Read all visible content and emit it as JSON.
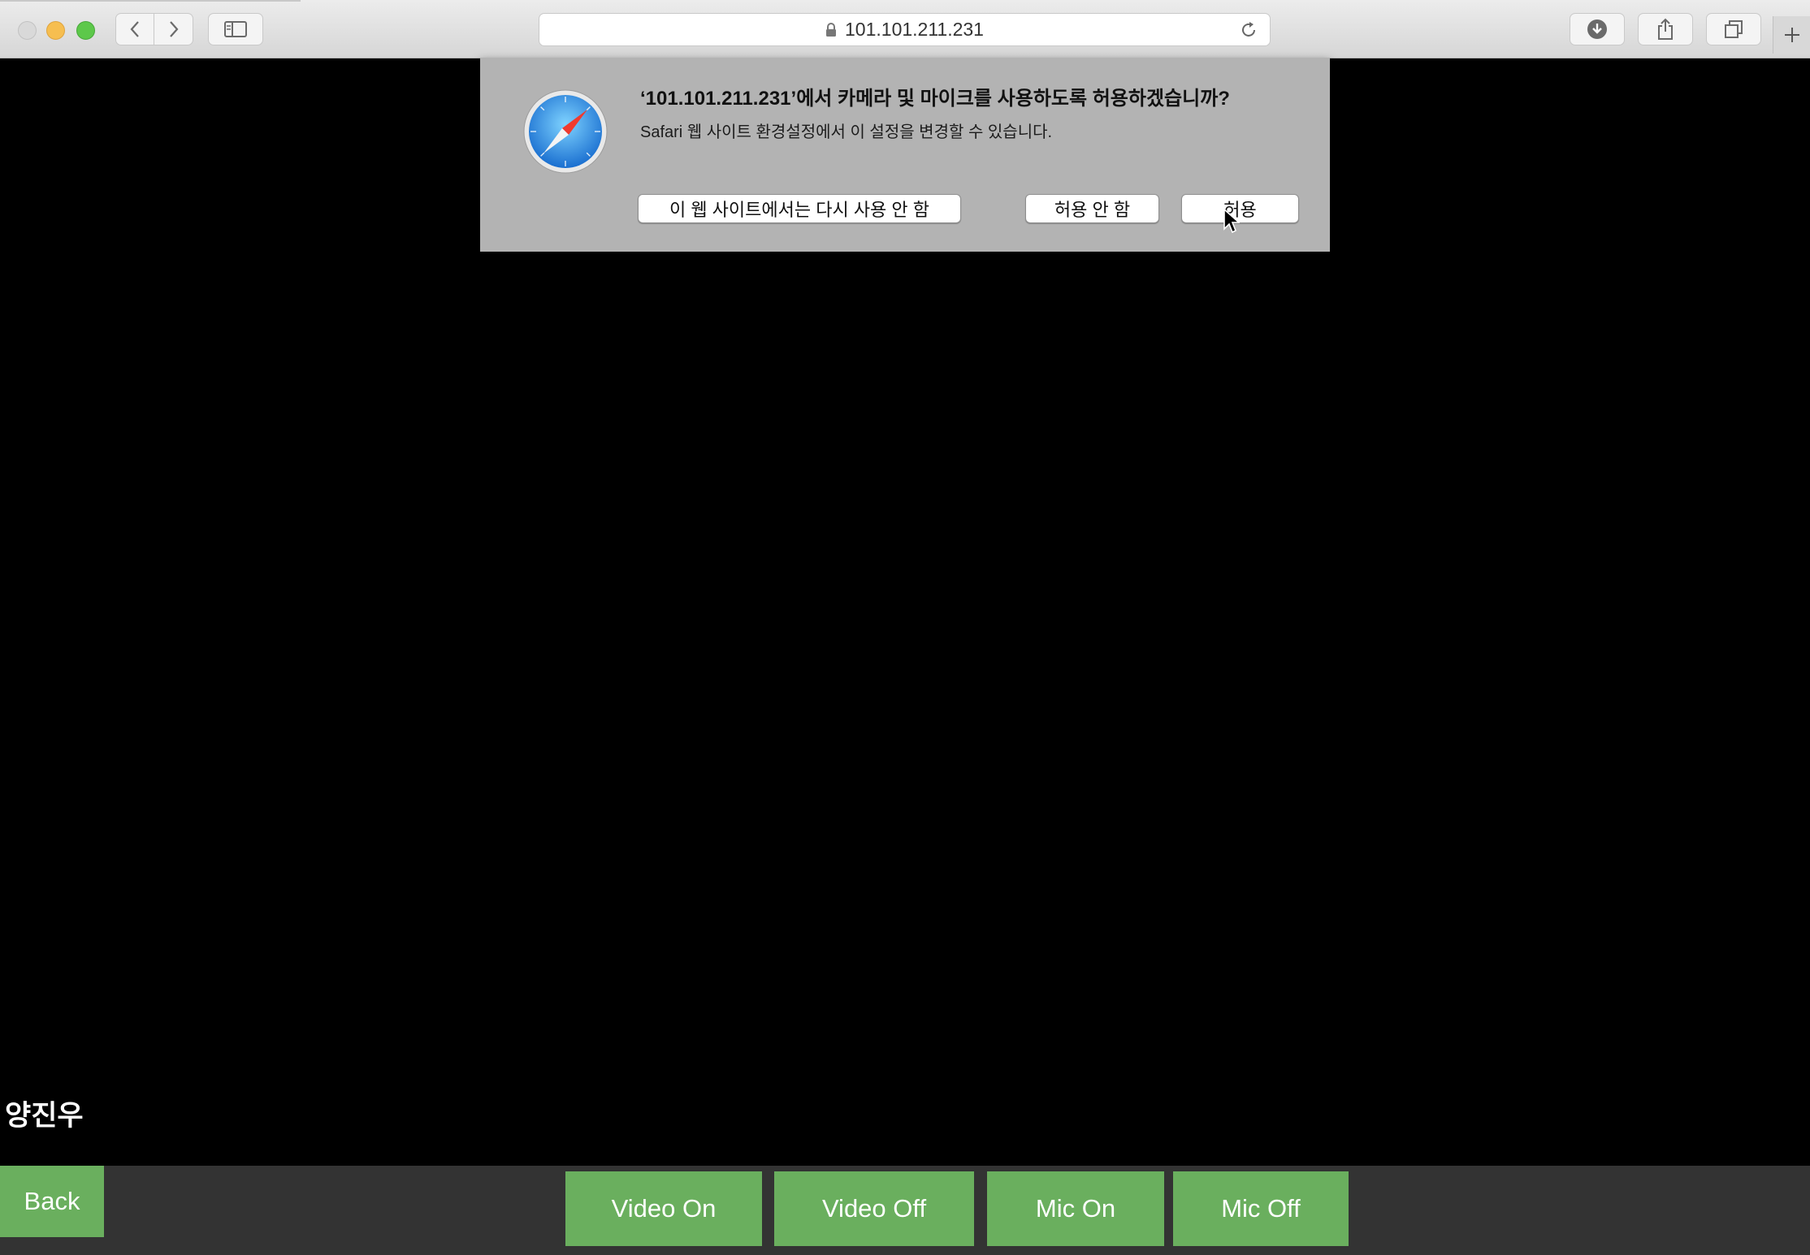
{
  "browser": {
    "url": "101.101.211.231",
    "icons": {
      "back": "chevron-left-icon",
      "forward": "chevron-right-icon",
      "sidebar": "sidebar-icon",
      "lock": "lock-icon",
      "reload": "reload-icon",
      "downloads": "download-icon",
      "share": "share-icon",
      "tabs": "tabs-overview-icon",
      "new_tab": "plus-icon"
    }
  },
  "permission_dialog": {
    "title": "‘101.101.211.231’에서 카메라 및 마이크를 사용하도록 허용하겠습니까?",
    "subtitle": "Safari 웹 사이트 환경설정에서 이 설정을 변경할 수 있습니다.",
    "never_label": "이 웹 사이트에서는 다시 사용 안 함",
    "deny_label": "허용 안 함",
    "allow_label": "허용",
    "icon": "safari-compass-icon"
  },
  "page": {
    "user_name": "양진우",
    "back_label": "Back",
    "controls": {
      "video_on": "Video On",
      "video_off": "Video Off",
      "mic_on": "Mic On",
      "mic_off": "Mic Off"
    },
    "accent_color": "#6aaf5e",
    "bar_color": "#333333"
  }
}
